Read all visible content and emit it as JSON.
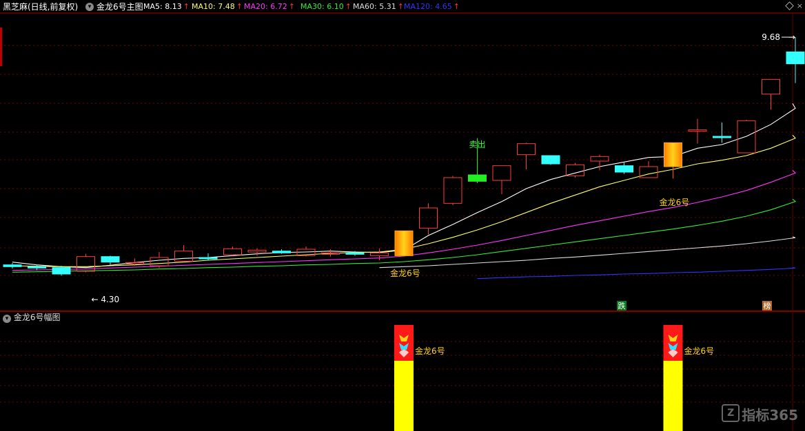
{
  "header": {
    "stock_name": "黑芝麻(日线,前复权)",
    "indicator_name": "金龙6号主图",
    "ma": [
      {
        "label": "MA5: 8.13",
        "arrow": "↑",
        "color": "#ffffff"
      },
      {
        "label": "MA10: 7.48",
        "arrow": "↑",
        "color": "#ffff66"
      },
      {
        "label": "MA20: 6.72",
        "arrow": "↑",
        "color": "#ff33ff"
      },
      {
        "label": "MA30: 6.10",
        "arrow": "↑",
        "color": "#33ee33"
      },
      {
        "label": "MA60: 5.31",
        "arrow": "↑",
        "color": "#dddddd"
      },
      {
        "label": "MA120: 4.65",
        "arrow": "↑",
        "color": "#3333ff"
      }
    ],
    "arrow_color": "#ff3333",
    "close_glyph": "×"
  },
  "sub_panel": {
    "title": "金龙6号幅图",
    "labels": [
      "金龙6号",
      "金龙6号"
    ]
  },
  "annotations": {
    "high": "9.68",
    "low": "4.30",
    "sell": "卖出",
    "signal": [
      "金龙6号",
      "金龙6号"
    ],
    "badge_fall": "跌",
    "badge_rank": "榜"
  },
  "watermark": {
    "logo": "Z",
    "text": "指标365"
  },
  "colors": {
    "up": "#ff3b3b",
    "down": "#33ffff",
    "background": "#000000",
    "gold": "#ffcc00"
  },
  "chart_data": {
    "type": "candlestick",
    "ylim": [
      4.0,
      10.0
    ],
    "candles": [
      {
        "o": 4.72,
        "h": 4.76,
        "l": 4.64,
        "c": 4.68,
        "dir": "down"
      },
      {
        "o": 4.68,
        "h": 4.72,
        "l": 4.6,
        "c": 4.66,
        "dir": "down"
      },
      {
        "o": 4.66,
        "h": 4.7,
        "l": 4.48,
        "c": 4.52,
        "dir": "down"
      },
      {
        "o": 4.58,
        "h": 4.96,
        "l": 4.56,
        "c": 4.9,
        "dir": "up"
      },
      {
        "o": 4.9,
        "h": 4.92,
        "l": 4.72,
        "c": 4.78,
        "dir": "down"
      },
      {
        "o": 4.74,
        "h": 4.86,
        "l": 4.7,
        "c": 4.77,
        "dir": "up"
      },
      {
        "o": 4.7,
        "h": 5.0,
        "l": 4.65,
        "c": 4.88,
        "dir": "up"
      },
      {
        "o": 4.8,
        "h": 5.15,
        "l": 4.78,
        "c": 5.02,
        "dir": "up"
      },
      {
        "o": 4.86,
        "h": 4.97,
        "l": 4.82,
        "c": 4.88,
        "dir": "down"
      },
      {
        "o": 4.94,
        "h": 5.12,
        "l": 4.92,
        "c": 5.07,
        "dir": "up"
      },
      {
        "o": 5.0,
        "h": 5.08,
        "l": 4.92,
        "c": 5.04,
        "dir": "up"
      },
      {
        "o": 5.02,
        "h": 5.06,
        "l": 4.96,
        "c": 4.98,
        "dir": "down"
      },
      {
        "o": 4.92,
        "h": 5.12,
        "l": 4.9,
        "c": 5.06,
        "dir": "up"
      },
      {
        "o": 4.97,
        "h": 5.06,
        "l": 4.9,
        "c": 4.98,
        "dir": "up"
      },
      {
        "o": 4.98,
        "h": 5.02,
        "l": 4.92,
        "c": 4.95,
        "dir": "down"
      },
      {
        "o": 4.92,
        "h": 5.08,
        "l": 4.82,
        "c": 4.98,
        "dir": "up"
      },
      {
        "o": 4.92,
        "h": 5.46,
        "l": 4.92,
        "c": 5.46,
        "dir": "gold"
      },
      {
        "o": 5.52,
        "h": 6.06,
        "l": 5.38,
        "c": 5.96,
        "dir": "up"
      },
      {
        "o": 6.06,
        "h": 6.66,
        "l": 6.02,
        "c": 6.62,
        "dir": "up"
      },
      {
        "o": 6.68,
        "h": 7.48,
        "l": 6.5,
        "c": 6.54,
        "dir": "green"
      },
      {
        "o": 6.56,
        "h": 6.88,
        "l": 6.26,
        "c": 6.88,
        "dir": "up"
      },
      {
        "o": 7.12,
        "h": 7.38,
        "l": 6.8,
        "c": 7.36,
        "dir": "up"
      },
      {
        "o": 7.1,
        "h": 6.96,
        "l": 6.9,
        "c": 6.92,
        "dir": "down"
      },
      {
        "o": 6.66,
        "h": 6.94,
        "l": 6.62,
        "c": 6.9,
        "dir": "up"
      },
      {
        "o": 6.98,
        "h": 7.12,
        "l": 6.78,
        "c": 7.08,
        "dir": "up"
      },
      {
        "o": 6.88,
        "h": 6.96,
        "l": 6.7,
        "c": 6.74,
        "dir": "down"
      },
      {
        "o": 6.62,
        "h": 6.98,
        "l": 6.62,
        "c": 6.86,
        "dir": "up"
      },
      {
        "o": 6.86,
        "h": 7.38,
        "l": 6.6,
        "c": 7.38,
        "dir": "gold"
      },
      {
        "o": 7.64,
        "h": 7.9,
        "l": 7.36,
        "c": 7.66,
        "dir": "up"
      },
      {
        "o": 7.52,
        "h": 7.82,
        "l": 7.38,
        "c": 7.5,
        "dir": "down"
      },
      {
        "o": 7.16,
        "h": 7.88,
        "l": 7.15,
        "c": 7.86,
        "dir": "up"
      },
      {
        "o": 8.44,
        "h": 8.76,
        "l": 8.1,
        "c": 8.76,
        "dir": "up"
      },
      {
        "o": 9.1,
        "h": 9.68,
        "l": 8.68,
        "c": 9.36,
        "dir": "down"
      }
    ],
    "ma_series": [
      {
        "name": "MA5",
        "color": "#ffffff",
        "values": [
          4.78,
          4.72,
          4.68,
          4.66,
          4.71,
          4.77,
          4.82,
          4.86,
          4.88,
          4.92,
          4.96,
          4.99,
          5.0,
          5.02,
          5.0,
          4.99,
          5.04,
          5.36,
          5.6,
          5.86,
          6.1,
          6.38,
          6.58,
          6.72,
          6.86,
          6.96,
          7.06,
          7.08,
          7.26,
          7.34,
          7.52,
          7.78,
          8.13
        ]
      },
      {
        "name": "MA10",
        "color": "#ffff66",
        "values": [
          4.7,
          4.69,
          4.68,
          4.68,
          4.7,
          4.72,
          4.75,
          4.78,
          4.82,
          4.85,
          4.88,
          4.91,
          4.94,
          4.97,
          4.99,
          5.0,
          5.06,
          5.18,
          5.32,
          5.48,
          5.66,
          5.86,
          6.06,
          6.24,
          6.42,
          6.56,
          6.7,
          6.8,
          6.92,
          7.0,
          7.1,
          7.26,
          7.48
        ]
      },
      {
        "name": "MA20",
        "color": "#ff33ff",
        "values": [
          4.6,
          4.61,
          4.62,
          4.63,
          4.65,
          4.67,
          4.69,
          4.71,
          4.73,
          4.75,
          4.77,
          4.79,
          4.81,
          4.83,
          4.85,
          4.87,
          4.91,
          4.98,
          5.06,
          5.15,
          5.25,
          5.36,
          5.47,
          5.58,
          5.68,
          5.78,
          5.88,
          5.97,
          6.08,
          6.2,
          6.34,
          6.52,
          6.72
        ]
      },
      {
        "name": "MA30",
        "color": "#33ee33",
        "values": [
          4.56,
          4.57,
          4.58,
          4.59,
          4.6,
          4.61,
          4.63,
          4.64,
          4.66,
          4.67,
          4.69,
          4.7,
          4.72,
          4.73,
          4.75,
          4.76,
          4.79,
          4.83,
          4.88,
          4.94,
          5.01,
          5.08,
          5.15,
          5.22,
          5.29,
          5.36,
          5.43,
          5.5,
          5.58,
          5.67,
          5.78,
          5.92,
          6.1
        ]
      },
      {
        "name": "MA60",
        "color": "#dddddd",
        "values": [
          null,
          null,
          null,
          null,
          null,
          null,
          null,
          null,
          null,
          null,
          null,
          null,
          null,
          null,
          null,
          4.66,
          4.68,
          4.7,
          4.73,
          4.76,
          4.79,
          4.82,
          4.86,
          4.89,
          4.93,
          4.97,
          5.01,
          5.05,
          5.09,
          5.13,
          5.18,
          5.24,
          5.31
        ]
      },
      {
        "name": "MA120",
        "color": "#3333ff",
        "values": [
          null,
          null,
          null,
          null,
          null,
          null,
          null,
          null,
          null,
          null,
          null,
          null,
          null,
          null,
          null,
          null,
          null,
          null,
          null,
          4.42,
          4.44,
          4.46,
          4.47,
          4.49,
          4.5,
          4.52,
          4.53,
          4.55,
          4.56,
          4.58,
          4.6,
          4.62,
          4.65
        ]
      }
    ],
    "signal_indices": [
      16,
      27
    ],
    "sell_index": 19
  }
}
